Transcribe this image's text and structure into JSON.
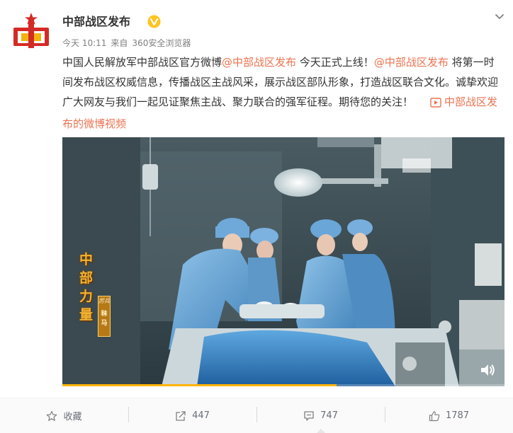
{
  "post": {
    "author": "中部战区发布",
    "time": "今天 10:11",
    "source_prefix": "来自",
    "source": "360安全浏览器",
    "text_1": "中国人民解放军中部战区官方微博",
    "mention_1": "@中部战区发布",
    "text_2": " 今天正式上线！",
    "mention_2": "@中部战区发布",
    "text_3": " 将第一时间发布战区权威信息，传播战区主战风采，展示战区部队形象，打造战区联合文化。诚挚欢迎广大网友与我们一起见证聚焦主战、聚力联合的强军征程。期待您的关注！",
    "video_link": "中部战区发布的微博视频"
  },
  "video": {
    "overlay_title": "中部力量",
    "badge_label": "厉兵",
    "badge_name": "秣马",
    "progress": 0.62
  },
  "actions": {
    "favorite": "收藏",
    "repost": "447",
    "comment": "747",
    "like": "1787"
  },
  "colors": {
    "link": "#eb7350",
    "avatar_red": "#d42a26",
    "avatar_gold": "#f3b30f",
    "verify_gold": "#ffc31e"
  },
  "icons": {
    "verify": "verified-badge-icon",
    "menu": "chevron-down-icon",
    "video_link": "video-play-icon",
    "favorite": "star-icon",
    "repost": "repost-icon",
    "comment": "comment-icon",
    "like": "thumbs-up-icon",
    "volume": "volume-icon"
  }
}
